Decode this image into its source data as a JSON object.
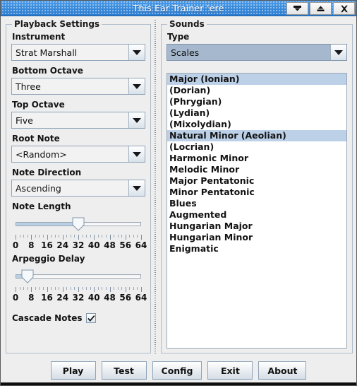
{
  "window": {
    "title": "This Ear Trainer 'ere",
    "buttons": {
      "minimize": "minimize-icon",
      "maximize": "maximize-icon",
      "close": "close-icon"
    }
  },
  "playback": {
    "group_title": "Playback Settings",
    "instrument": {
      "label": "Instrument",
      "value": "Strat Marshall"
    },
    "bottom_octave": {
      "label": "Bottom Octave",
      "value": "Three"
    },
    "top_octave": {
      "label": "Top Octave",
      "value": "Five"
    },
    "root_note": {
      "label": "Root Note",
      "value": "<Random>"
    },
    "note_direction": {
      "label": "Note Direction",
      "value": "Ascending"
    },
    "note_length": {
      "label": "Note Length",
      "value": 32,
      "min": 0,
      "max": 64,
      "tick_labels": [
        "0",
        "8",
        "16",
        "24",
        "32",
        "40",
        "48",
        "56",
        "64"
      ]
    },
    "arpeggio_delay": {
      "label": "Arpeggio Delay",
      "value": 6,
      "min": 0,
      "max": 64,
      "tick_labels": [
        "0",
        "8",
        "16",
        "24",
        "32",
        "40",
        "48",
        "56",
        "64"
      ]
    },
    "cascade_notes": {
      "label": "Cascade Notes",
      "checked": true
    }
  },
  "sounds": {
    "group_title": "Sounds",
    "type": {
      "label": "Type",
      "value": "Scales"
    },
    "items": [
      {
        "label": "Major (Ionian)",
        "selected": true
      },
      {
        "label": "(Dorian)",
        "selected": false
      },
      {
        "label": "(Phrygian)",
        "selected": false
      },
      {
        "label": "(Lydian)",
        "selected": false
      },
      {
        "label": "(Mixolydian)",
        "selected": false
      },
      {
        "label": "Natural Minor (Aeolian)",
        "selected": true
      },
      {
        "label": "(Locrian)",
        "selected": false
      },
      {
        "label": "Harmonic Minor",
        "selected": false
      },
      {
        "label": "Melodic Minor",
        "selected": false
      },
      {
        "label": "Major Pentatonic",
        "selected": false
      },
      {
        "label": "Minor Pentatonic",
        "selected": false
      },
      {
        "label": "Blues",
        "selected": false
      },
      {
        "label": "Augmented",
        "selected": false
      },
      {
        "label": "Hungarian Major",
        "selected": false
      },
      {
        "label": "Hungarian Minor",
        "selected": false
      },
      {
        "label": "Enigmatic",
        "selected": false
      }
    ]
  },
  "actions": {
    "play": "Play",
    "test": "Test",
    "config": "Config",
    "exit": "Exit",
    "about": "About"
  },
  "colors": {
    "titlebar": "#2b7bd0",
    "selection": "#bcd0e8",
    "combo_focus": "#a5b8ce",
    "panel": "#eeeeee"
  }
}
